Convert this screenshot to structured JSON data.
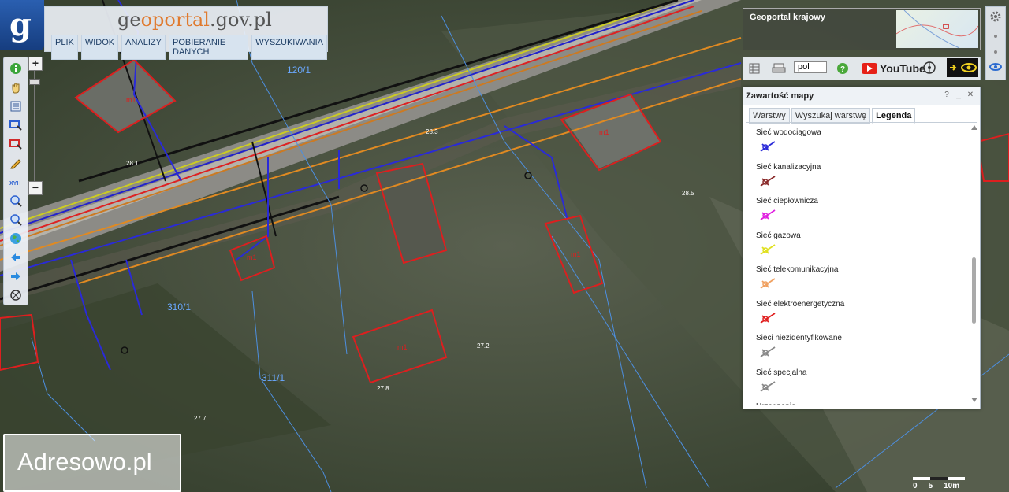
{
  "header": {
    "title_part1": "ge",
    "title_part2": "oportal",
    "title_part3": ".gov.pl",
    "menu": [
      "PLIK",
      "WIDOK",
      "ANALIZY",
      "POBIERANIE DANYCH",
      "WYSZUKIWANIA"
    ]
  },
  "overview": {
    "title": "Geoportal krajowy"
  },
  "toolbar_right": {
    "language": "pol",
    "youtube_label": "YouTube"
  },
  "panel": {
    "title": "Zawartość mapy",
    "controls": [
      "?",
      "_",
      "✕"
    ],
    "tabs": [
      "Warstwy",
      "Wyszukaj warstwę",
      "Legenda"
    ],
    "active_tab": "Legenda",
    "legend": [
      {
        "label": "Sieć wodociągowa",
        "color": "#2a2ad8"
      },
      {
        "label": "Sieć kanalizacyjna",
        "color": "#8a2a2a"
      },
      {
        "label": "Sieć ciepłownicza",
        "color": "#e020e0"
      },
      {
        "label": "Sieć gazowa",
        "color": "#e0e020"
      },
      {
        "label": "Sieć telekomunikacyjna",
        "color": "#f0a060"
      },
      {
        "label": "Sieć elektroenergetyczna",
        "color": "#e02020"
      },
      {
        "label": "Sieci niezidentyfikowane",
        "color": "#888888"
      },
      {
        "label": "Sieć specjalna",
        "color": "#888888"
      },
      {
        "label": "Urządzenia",
        "color": "#888888"
      }
    ]
  },
  "map_labels": {
    "parcels": [
      "120/1",
      "310/1",
      "311/1"
    ],
    "buildings": [
      "m1",
      "m1",
      "m1",
      "m1",
      "m1"
    ],
    "heights": [
      "28.5",
      "27.2",
      "27.8",
      "27.7",
      "28.1",
      "28.3"
    ]
  },
  "watermark": "Adresowo.pl",
  "scale": [
    "0",
    "5",
    "10m"
  ]
}
